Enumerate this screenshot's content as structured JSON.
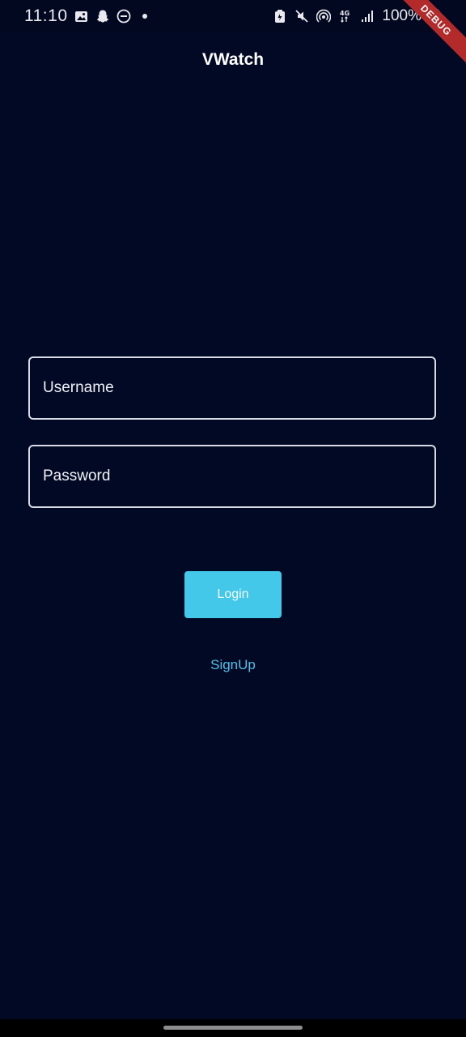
{
  "status_bar": {
    "time": "11:10",
    "battery": "100%",
    "icons_left": [
      "gallery-icon",
      "snapchat-icon",
      "do-not-disturb-icon",
      "dot-icon"
    ],
    "icons_right": [
      "battery-saver-icon",
      "mute-icon",
      "hotspot-icon",
      "4g-icon",
      "signal-icon",
      "battery-icon"
    ]
  },
  "debug_banner": "DEBUG",
  "app": {
    "title": "VWatch"
  },
  "form": {
    "username_placeholder": "Username",
    "password_placeholder": "Password",
    "login_label": "Login",
    "signup_label": "SignUp"
  },
  "colors": {
    "background": "#020925",
    "button": "#43c8ea",
    "link": "#4cc2e8",
    "field_border": "#d8dbe6"
  }
}
